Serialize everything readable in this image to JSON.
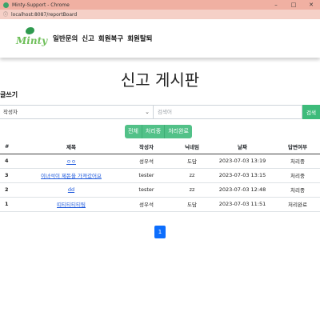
{
  "browser": {
    "window_title": "Minty-Support - Chrome",
    "url": "localhost:8087/reportBoard"
  },
  "nav": {
    "logo_text": "Minty",
    "links": [
      "일반문의",
      "신고",
      "회원복구",
      "회원탈퇴"
    ]
  },
  "page": {
    "title": "신고 게시판",
    "write_label": "글쓰기"
  },
  "search": {
    "select_value": "작성자",
    "placeholder": "검색어",
    "button_label": "검색"
  },
  "filters": [
    "전체",
    "처리중",
    "처리완료"
  ],
  "table": {
    "headers": [
      "#",
      "제목",
      "작성자",
      "닉네임",
      "날짜",
      "답변여부"
    ],
    "rows": [
      {
        "num": "4",
        "title": "ㅇㅇ",
        "author": "성우석",
        "nickname": "도담",
        "date": "2023-07-03 13:19",
        "status": "처리중"
      },
      {
        "num": "3",
        "title": "이녀석이 제돈을 가져갔어요",
        "author": "tester",
        "nickname": "zz",
        "date": "2023-07-03 13:15",
        "status": "처리중"
      },
      {
        "num": "2",
        "title": "dd",
        "author": "tester",
        "nickname": "zz",
        "date": "2023-07-03 12:48",
        "status": "처리중"
      },
      {
        "num": "1",
        "title": "띠티티티티팀",
        "author": "성우석",
        "nickname": "도담",
        "date": "2023-07-03 11:51",
        "status": "처리완료"
      }
    ]
  },
  "pagination": {
    "current": "1"
  },
  "colors": {
    "accent_green": "#52c188",
    "page_blue": "#0d6efd",
    "link_blue": "#1a56db"
  }
}
